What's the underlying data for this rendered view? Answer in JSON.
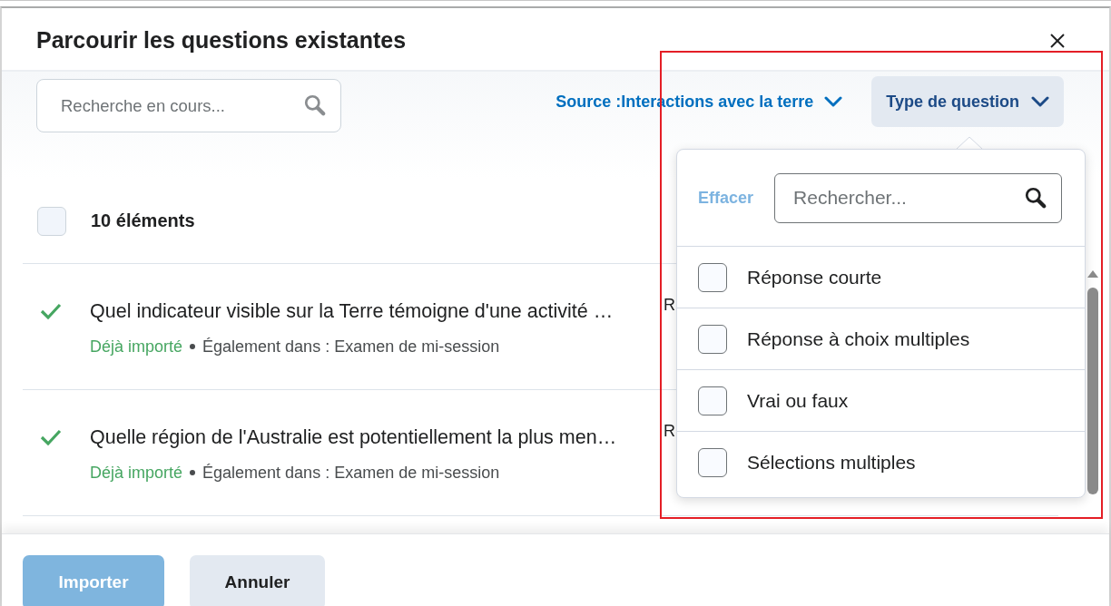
{
  "dialog": {
    "title": "Parcourir les questions existantes"
  },
  "toolbar": {
    "search": {
      "placeholder": "Recherche en cours..."
    },
    "source_filter": {
      "label": "Source :Interactions avec la terre"
    },
    "type_filter": {
      "label": "Type de question",
      "expanded": true
    }
  },
  "list": {
    "select_all": {
      "checked": false
    },
    "count": "10 éléments",
    "rows": [
      {
        "title": "Quel indicateur visible sur la Terre témoigne d'une activité …",
        "imported": true,
        "status": "Déjà importé",
        "also_in": "Également dans : Examen de mi-session",
        "column_2": "R"
      },
      {
        "title": "Quelle région de l'Australie est potentiellement la plus men…",
        "imported": true,
        "status": "Déjà importé",
        "also_in": "Également dans : Examen de mi-session",
        "column_2": "R"
      }
    ]
  },
  "type_popover": {
    "clear": {
      "label": "Effacer",
      "disabled": true
    },
    "search": {
      "placeholder": "Rechercher..."
    },
    "options": [
      {
        "label": "Réponse courte",
        "checked": false
      },
      {
        "label": "Réponse à choix multiples",
        "checked": false
      },
      {
        "label": "Vrai ou faux",
        "checked": false
      },
      {
        "label": "Sélections multiples",
        "checked": false
      }
    ]
  },
  "buttons": [
    {
      "label": "Importer",
      "kind": "primary",
      "disabled": true
    },
    {
      "label": "Annuler",
      "kind": "secondary",
      "disabled": false
    }
  ]
}
